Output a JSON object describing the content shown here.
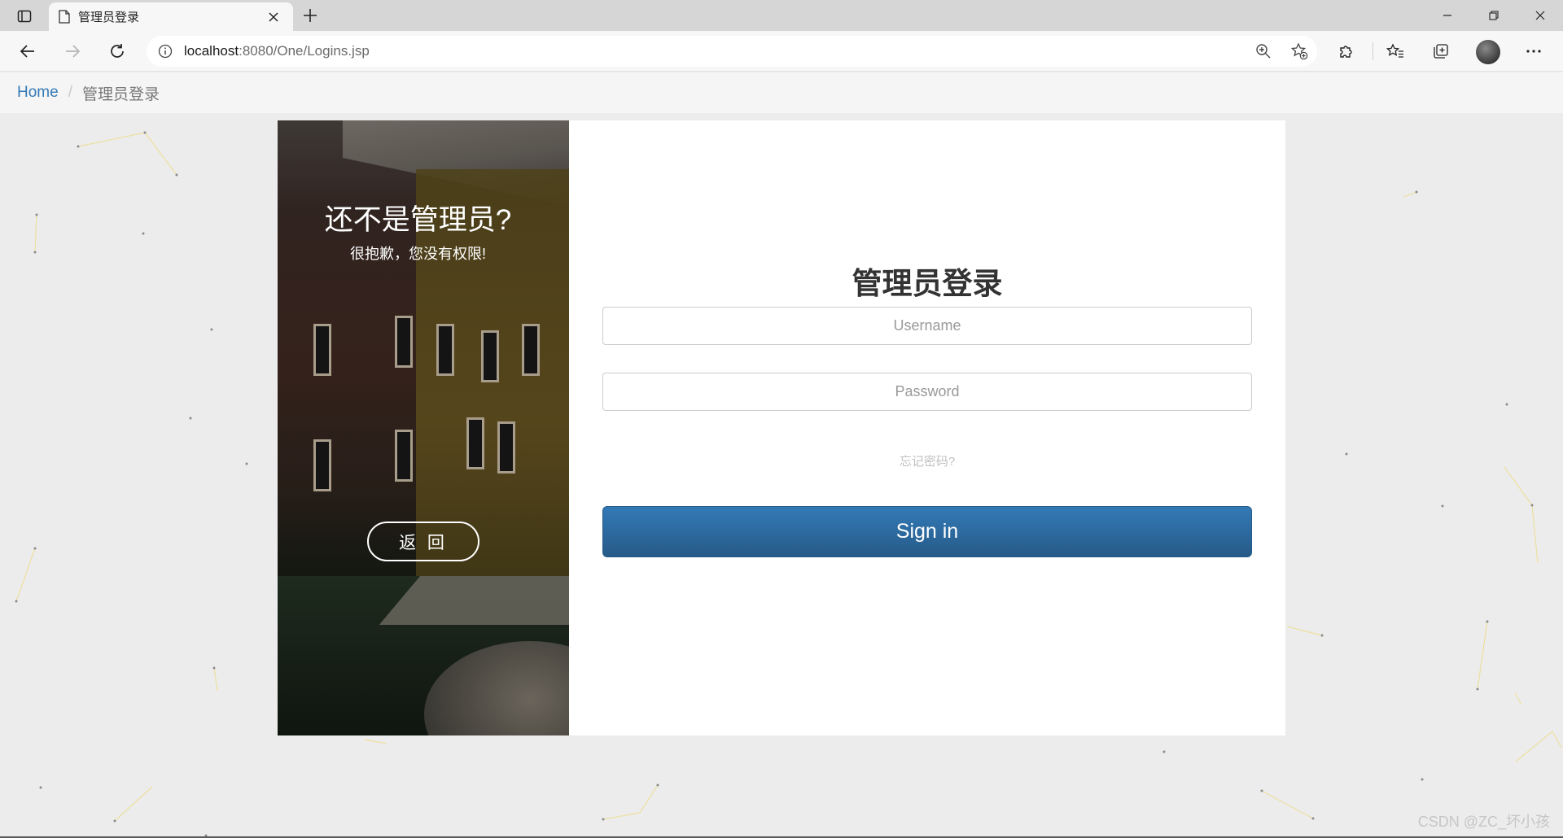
{
  "browser": {
    "tab_title": "管理员登录",
    "url_host": "localhost",
    "url_path": ":8080/One/Logins.jsp"
  },
  "breadcrumb": {
    "home": "Home",
    "separator": "/",
    "current": "管理员登录"
  },
  "side_panel": {
    "heading": "还不是管理员?",
    "subheading": "很抱歉，您没有权限!",
    "back_label": "返 回"
  },
  "login_form": {
    "title": "管理员登录",
    "username_placeholder": "Username",
    "password_placeholder": "Password",
    "forgot_link": "忘记密码?",
    "signin_label": "Sign in"
  },
  "watermark": "CSDN @ZC_坏小孩",
  "colors": {
    "accent": "#337ab7",
    "button_bottom": "#265a88",
    "page_bg": "#ececec"
  }
}
